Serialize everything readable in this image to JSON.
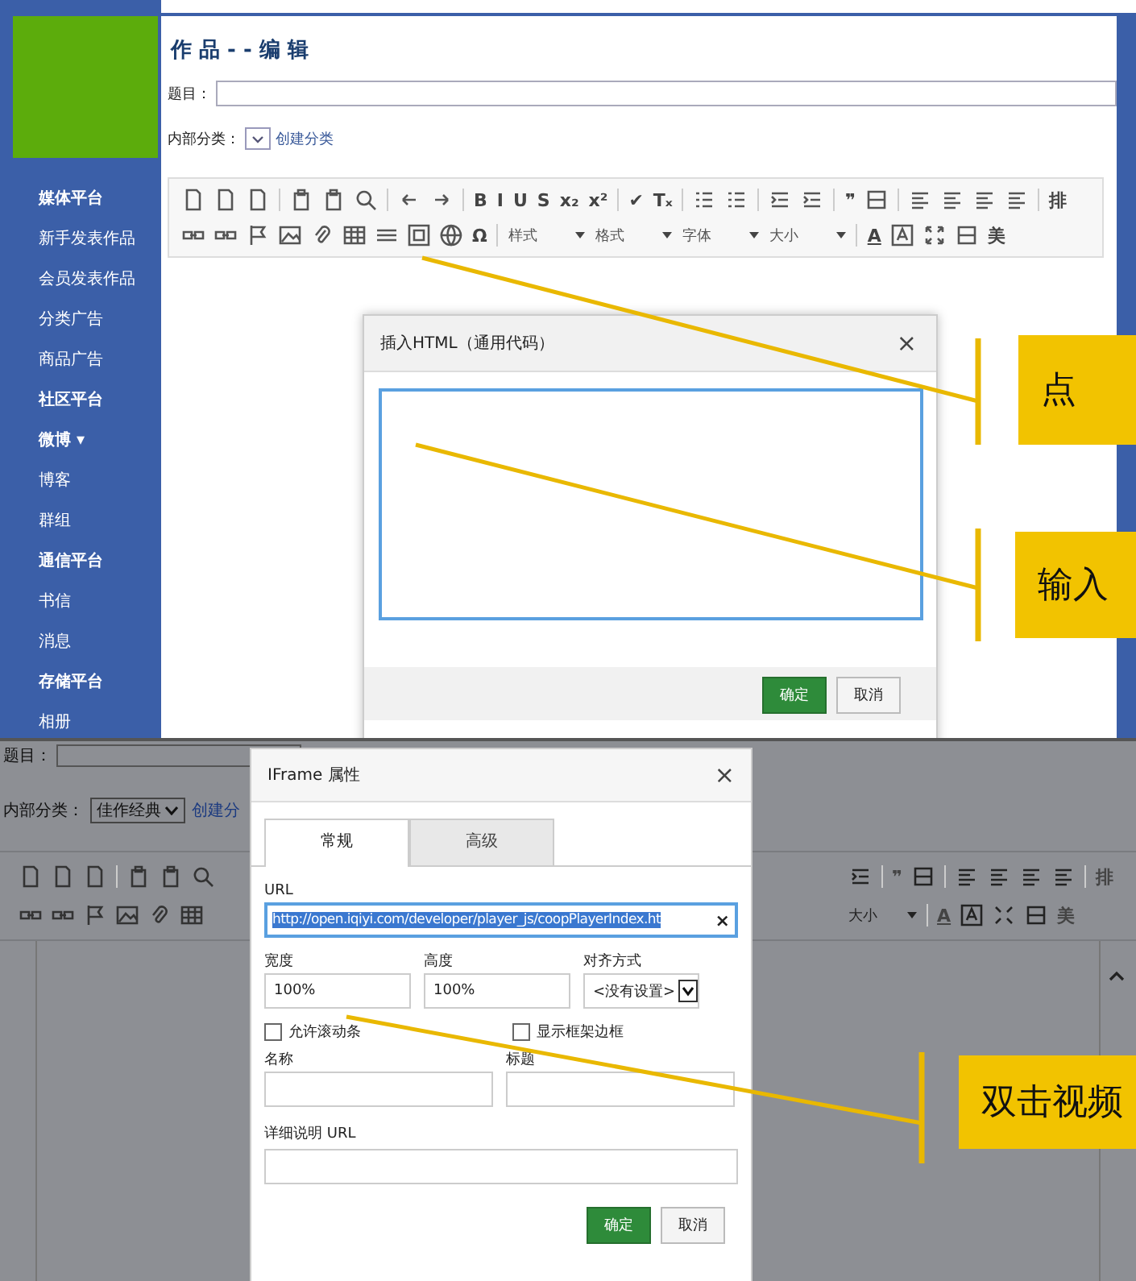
{
  "sidebar": {
    "items": [
      {
        "label": "媒体平台",
        "kind": "header"
      },
      {
        "label": "新手发表作品",
        "kind": "item"
      },
      {
        "label": "会员发表作品",
        "kind": "item"
      },
      {
        "label": "分类广告",
        "kind": "item"
      },
      {
        "label": "商品广告",
        "kind": "item"
      },
      {
        "label": "社区平台",
        "kind": "header"
      },
      {
        "label": "微博 ▾",
        "kind": "header"
      },
      {
        "label": "博客",
        "kind": "item"
      },
      {
        "label": "群组",
        "kind": "item"
      },
      {
        "label": "通信平台",
        "kind": "header"
      },
      {
        "label": "书信",
        "kind": "item"
      },
      {
        "label": "消息",
        "kind": "item"
      },
      {
        "label": "存储平台",
        "kind": "header"
      },
      {
        "label": "相册",
        "kind": "item"
      }
    ]
  },
  "top": {
    "title": "作 品 - - 编 辑",
    "title_label": "题目：",
    "category_label": "内部分类：",
    "category_link": "创建分类",
    "toolbar": [
      [
        {
          "kind": "doc"
        },
        {
          "kind": "doc"
        },
        {
          "kind": "doc"
        },
        {
          "kind": "sep"
        },
        {
          "kind": "paste"
        },
        {
          "kind": "paste"
        },
        {
          "kind": "search"
        },
        {
          "kind": "sep"
        },
        {
          "kind": "undo"
        },
        {
          "kind": "redo"
        },
        {
          "kind": "sep"
        },
        {
          "kind": "glyph",
          "label": "B"
        },
        {
          "kind": "glyph",
          "label": "I"
        },
        {
          "kind": "glyph",
          "label": "U"
        },
        {
          "kind": "glyph",
          "label": "S"
        },
        {
          "kind": "glyph",
          "label": "x₂"
        },
        {
          "kind": "glyph",
          "label": "x²"
        },
        {
          "kind": "sep"
        },
        {
          "kind": "glyph",
          "label": "✔"
        },
        {
          "kind": "glyph",
          "label": "Tₓ"
        },
        {
          "kind": "sep"
        },
        {
          "kind": "list"
        },
        {
          "kind": "list"
        },
        {
          "kind": "sep"
        },
        {
          "kind": "indent"
        },
        {
          "kind": "indent"
        },
        {
          "kind": "sep"
        },
        {
          "kind": "glyph",
          "label": "❞"
        },
        {
          "kind": "blocks"
        },
        {
          "kind": "sep"
        },
        {
          "kind": "align"
        },
        {
          "kind": "align"
        },
        {
          "kind": "align"
        },
        {
          "kind": "align"
        },
        {
          "kind": "sep"
        },
        {
          "kind": "glyph",
          "label": "排"
        }
      ],
      [
        {
          "kind": "link"
        },
        {
          "kind": "link"
        },
        {
          "kind": "flag"
        },
        {
          "kind": "image"
        },
        {
          "kind": "clip"
        },
        {
          "kind": "table"
        },
        {
          "kind": "rule"
        },
        {
          "kind": "frame"
        },
        {
          "kind": "globe"
        },
        {
          "kind": "glyph",
          "label": "Ω"
        },
        {
          "kind": "sep"
        },
        {
          "kind": "select",
          "label": "样式"
        },
        {
          "kind": "select",
          "label": "格式"
        },
        {
          "kind": "select",
          "label": "字体"
        },
        {
          "kind": "select",
          "label": "大小"
        },
        {
          "kind": "sep"
        },
        {
          "kind": "color",
          "label": "A"
        },
        {
          "kind": "bgcolor"
        },
        {
          "kind": "fullscreen"
        },
        {
          "kind": "blocks"
        },
        {
          "kind": "glyph",
          "label": "美"
        }
      ]
    ]
  },
  "html_dialog": {
    "title": "插入HTML（通用代码）",
    "close": "×",
    "buttons": [
      {
        "label": "确定",
        "kind": "primary"
      },
      {
        "label": "取消",
        "kind": "secondary"
      }
    ]
  },
  "bottom": {
    "title_label": "题目：",
    "category_label": "内部分类：",
    "category_value": "佳作经典",
    "category_link": "创建分",
    "toolbar_left": [
      [
        {
          "kind": "doc"
        },
        {
          "kind": "doc"
        },
        {
          "kind": "doc"
        },
        {
          "kind": "sep"
        },
        {
          "kind": "paste"
        },
        {
          "kind": "paste"
        },
        {
          "kind": "search"
        }
      ],
      [
        {
          "kind": "link"
        },
        {
          "kind": "link"
        },
        {
          "kind": "flag"
        },
        {
          "kind": "image"
        },
        {
          "kind": "clip"
        },
        {
          "kind": "table"
        }
      ]
    ],
    "toolbar_right": [
      [
        {
          "kind": "indent"
        },
        {
          "kind": "sep"
        },
        {
          "kind": "glyph",
          "label": "❞"
        },
        {
          "kind": "blocks"
        },
        {
          "kind": "sep"
        },
        {
          "kind": "align"
        },
        {
          "kind": "align"
        },
        {
          "kind": "align"
        },
        {
          "kind": "align"
        },
        {
          "kind": "sep"
        },
        {
          "kind": "glyph",
          "label": "排"
        }
      ],
      [
        {
          "kind": "select",
          "label": "大小"
        },
        {
          "kind": "sep"
        },
        {
          "kind": "color",
          "label": "A"
        },
        {
          "kind": "bgcolor"
        },
        {
          "kind": "fullscreen"
        },
        {
          "kind": "blocks"
        },
        {
          "kind": "glyph",
          "label": "美"
        }
      ]
    ]
  },
  "iframe_dialog": {
    "title": "IFrame 属性",
    "close": "×",
    "tabs": [
      {
        "label": "常规",
        "selected": true
      },
      {
        "label": "高级",
        "selected": false
      }
    ],
    "url_label": "URL",
    "url_value": "http://open.iqiyi.com/developer/player_js/coopPlayerIndex.ht",
    "url_clear": "×",
    "width_label": "宽度",
    "width_value": "100%",
    "height_label": "高度",
    "height_value": "100%",
    "align_label": "对齐方式",
    "align_value": "<没有设置>",
    "checkboxes": [
      {
        "label": "允许滚动条",
        "checked": false
      },
      {
        "label": "显示框架边框",
        "checked": false
      }
    ],
    "name_label": "名称",
    "caption_label": "标题",
    "longdesc_label": "详细说明 URL",
    "buttons": [
      {
        "label": "确定",
        "kind": "primary"
      },
      {
        "label": "取消",
        "kind": "secondary"
      }
    ]
  },
  "callouts": [
    {
      "text": "点"
    },
    {
      "text": "输入"
    },
    {
      "text": "双击视频"
    }
  ]
}
